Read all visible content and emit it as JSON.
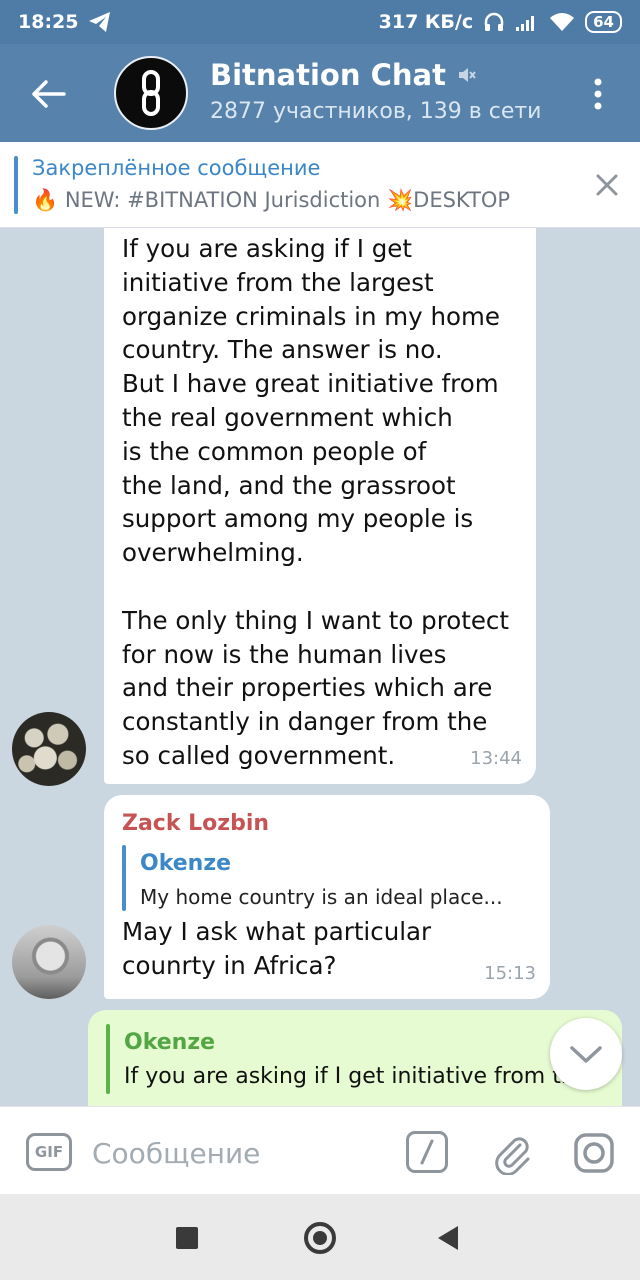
{
  "status_bar": {
    "time": "18:25",
    "network_speed": "317 КБ/с",
    "battery": "64",
    "icons": [
      "telegram-icon",
      "headphones-icon",
      "signal-icon",
      "wifi-icon",
      "battery-icon"
    ]
  },
  "header": {
    "title": "Bitnation Chat",
    "subtitle": "2877 участников, 139 в сети",
    "icons": [
      "back-arrow-icon",
      "muted-icon",
      "more-vert-icon"
    ]
  },
  "pinned": {
    "title": "Закреплённое сообщение",
    "text": "🔥 NEW: #BITNATION Jurisdiction 💥DESKTOP"
  },
  "messages": [
    {
      "text": "If you are asking if I get\ninitiative from the largest\norganize criminals in my home\ncountry. The answer is no.\nBut I have great initiative from\nthe real government which\nis the common people of\nthe land, and the grassroot\nsupport among my people is\noverwhelming.\n\nThe only thing I want to protect\nfor now is the human lives\nand their properties which are\nconstantly in danger from the\nso called government.",
      "time": "13:44"
    },
    {
      "sender": "Zack Lozbin",
      "reply_name": "Okenze",
      "reply_text": "My home country is an ideal place...",
      "text": "May I ask what particular\ncounrty in Africa?",
      "time": "15:13"
    },
    {
      "reply_name": "Okenze",
      "reply_text": "If you are asking if I get initiative from th"
    }
  ],
  "input": {
    "gif_label": "GIF",
    "placeholder": "Сообщение",
    "command_label": "/"
  },
  "colors": {
    "header": "#5682ab",
    "accent": "#3b87c8",
    "sender_red": "#c75454",
    "outgoing_bubble": "#e6fbd1"
  }
}
